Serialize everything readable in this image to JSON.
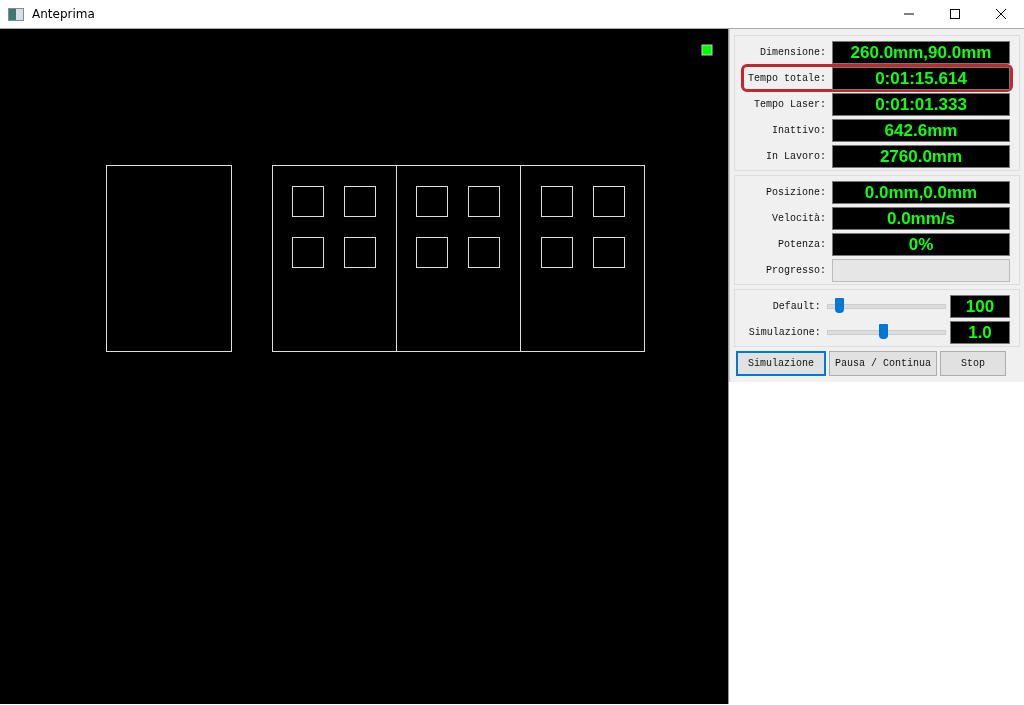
{
  "window": {
    "title": "Anteprima"
  },
  "stats": [
    {
      "label": "Dimensione:",
      "value": "260.0mm,90.0mm",
      "highlighted": false
    },
    {
      "label": "Tempo totale:",
      "value": "0:01:15.614",
      "highlighted": true
    },
    {
      "label": "Tempo Laser:",
      "value": "0:01:01.333",
      "highlighted": false
    },
    {
      "label": "Inattivo:",
      "value": "642.6mm",
      "highlighted": false
    },
    {
      "label": "In Lavoro:",
      "value": "2760.0mm",
      "highlighted": false
    }
  ],
  "status": [
    {
      "kind": "readout",
      "label": "Posizione:",
      "value": "0.0mm,0.0mm"
    },
    {
      "kind": "readout",
      "label": "Velocità:",
      "value": "0.0mm/s"
    },
    {
      "kind": "readout",
      "label": "Potenza:",
      "value": "0%"
    },
    {
      "kind": "progress",
      "label": "Progresso:",
      "level": 0
    }
  ],
  "speeds": [
    {
      "label": "Default:",
      "level": 0.1,
      "value": "100"
    },
    {
      "label": "Simulazione:",
      "level": 0.48,
      "value": "1.0"
    }
  ],
  "buttons": [
    {
      "label": "Simulazione",
      "selected": true
    },
    {
      "label": "Pausa / Continua",
      "selected": false
    },
    {
      "label": "Stop",
      "selected": false
    }
  ]
}
